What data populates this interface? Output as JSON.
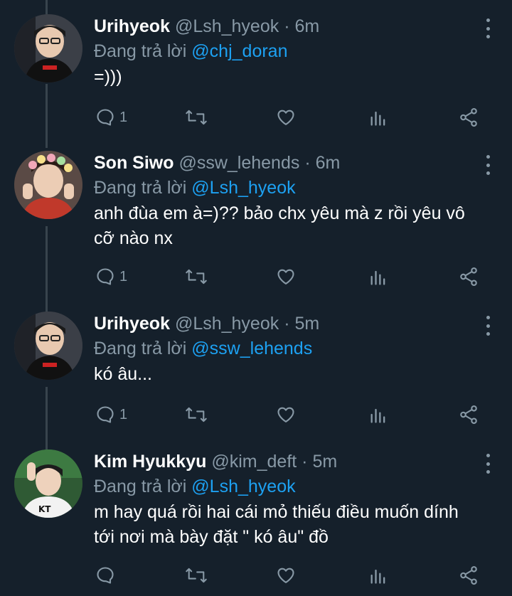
{
  "tweets": [
    {
      "name": "Urihyeok",
      "handle": "@Lsh_hyeok",
      "separator": "·",
      "time": "6m",
      "reply_prefix": "Đang trả lời",
      "reply_to": "@chj_doran",
      "text": "=)))",
      "replies": "1"
    },
    {
      "name": "Son Siwo",
      "handle": "@ssw_lehends",
      "separator": "·",
      "time": "6m",
      "reply_prefix": "Đang trả lời",
      "reply_to": "@Lsh_hyeok",
      "text": "anh đùa em à=)?? bảo chx yêu mà z rồi yêu vô cỡ nào nx",
      "replies": "1"
    },
    {
      "name": "Urihyeok",
      "handle": "@Lsh_hyeok",
      "separator": "·",
      "time": "5m",
      "reply_prefix": "Đang trả lời",
      "reply_to": "@ssw_lehends",
      "text": "kó âu...",
      "replies": "1"
    },
    {
      "name": "Kim Hyukkyu",
      "handle": "@kim_deft",
      "separator": "·",
      "time": "5m",
      "reply_prefix": "Đang trả lời",
      "reply_to": "@Lsh_hyeok",
      "text": "m hay quá rồi hai cái mỏ thiếu điều muốn dính tới nơi mà bày đặt \" kó âu\" đồ",
      "replies": ""
    }
  ],
  "colors": {
    "background": "#15202b",
    "secondary_text": "#8899a6",
    "mention": "#1da1f2",
    "thread_line": "#38444d"
  },
  "icons": [
    "reply-icon",
    "retweet-icon",
    "like-icon",
    "analytics-icon",
    "share-icon",
    "more-icon"
  ]
}
